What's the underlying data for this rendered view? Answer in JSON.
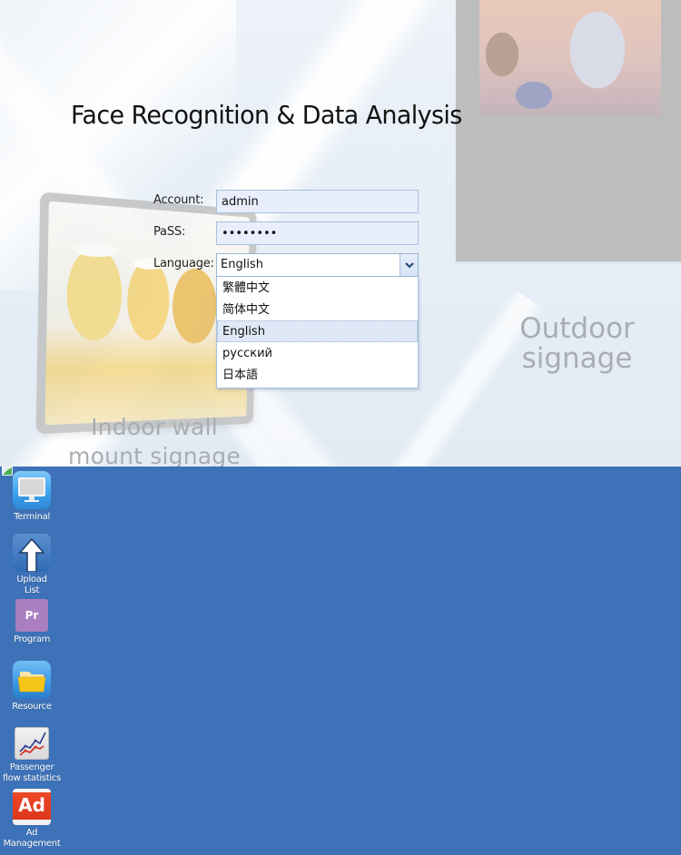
{
  "login": {
    "title": "Face Recognition & Data Analysis",
    "account_label": "Account:",
    "account_value": "admin",
    "password_label": "PaSS:",
    "password_value": "••••••••",
    "language_label": "Language:",
    "language_selected": "English",
    "language_options": [
      {
        "label": "繁體中文",
        "selected": false
      },
      {
        "label": "简体中文",
        "selected": false
      },
      {
        "label": "English",
        "selected": true
      },
      {
        "label": "русский",
        "selected": false
      },
      {
        "label": "日本語",
        "selected": false
      }
    ]
  },
  "background": {
    "indoor_caption_line1": "Indoor wall",
    "indoor_caption_line2": "mount signage",
    "outdoor_caption_line1": "Outdoor",
    "outdoor_caption_line2": "signage"
  },
  "desktop": {
    "background_color": "#3d72b8",
    "icons": [
      {
        "label": "Terminal",
        "icon": "monitor-icon"
      },
      {
        "label": "Upload List",
        "icon": "upload-arrow-icon"
      },
      {
        "label": "Program",
        "icon": "program-icon",
        "glyph_text": "Pr"
      },
      {
        "label": "Resource",
        "icon": "folder-icon"
      },
      {
        "label": "Passenger flow statistics",
        "icon": "line-chart-icon"
      },
      {
        "label": "Ad Management",
        "icon": "ad-icon",
        "glyph_text": "Ad"
      }
    ]
  }
}
